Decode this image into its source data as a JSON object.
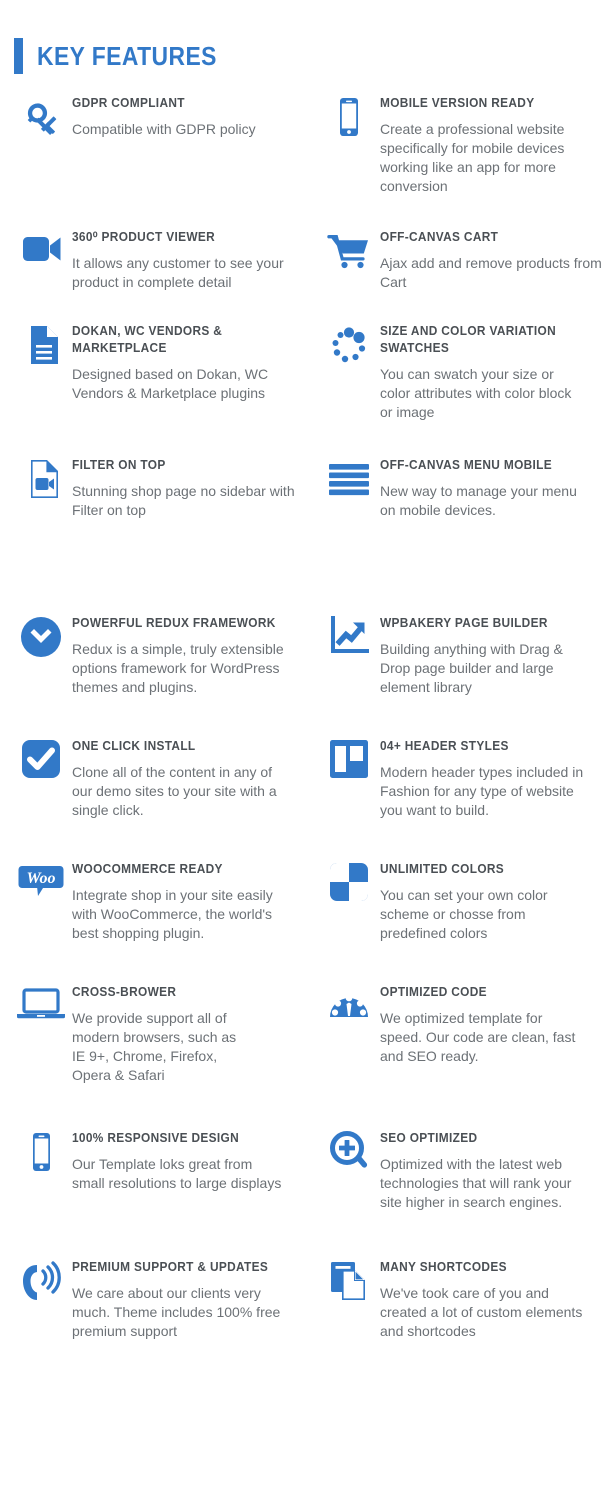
{
  "heading": {
    "bar_color": "#3279c8",
    "title": "KEY FEATURES"
  },
  "theme": {
    "accent": "#3279c8",
    "title_color": "#4a4f54",
    "body_color": "#6c7176",
    "background": "#ffffff"
  },
  "sections": [
    {
      "id": "section-1",
      "rows": [
        {
          "left": {
            "icon": "key-icon",
            "title": "GDPR COMPLIANT",
            "desc": "Compatible with GDPR policy"
          },
          "right": {
            "icon": "mobile-phone-icon",
            "title": "MOBILE VERSION READY",
            "desc": "Create a professional website specifically for mobile devices working like an app for more conversion"
          }
        },
        {
          "left": {
            "icon": "video-camera-icon",
            "title": "360⁰  PRODUCT VIEWER",
            "desc": "It allows any customer to see your product in complete detail"
          },
          "right": {
            "icon": "shopping-cart-icon",
            "title": "OFF-CANVAS CART",
            "desc": "Ajax add and remove products from Cart"
          }
        },
        {
          "left": {
            "icon": "document-lines-icon",
            "title": "DOKAN, WC VENDORS & MARKETPLACE",
            "desc": "Designed based on Dokan, WC Vendors & Marketplace plugins"
          },
          "right": {
            "icon": "spinner-dots-icon",
            "title": "SIZE AND COLOR VARIATION SWATCHES",
            "desc": "You can swatch your size or color attributes with color block or image"
          }
        },
        {
          "left": {
            "icon": "file-video-icon",
            "title": "FILTER ON TOP",
            "desc": "Stunning shop page no sidebar with Filter on top"
          },
          "right": {
            "icon": "hamburger-menu-icon",
            "title": "OFF-CANVAS MENU MOBILE",
            "desc": "New way to manage your menu on mobile devices."
          }
        }
      ]
    },
    {
      "id": "section-2",
      "rows": [
        {
          "left": {
            "icon": "chevron-down-circle-icon",
            "title": "POWERFUL REDUX FRAMEWORK",
            "desc": "Redux is a simple, truly extensible options framework for WordPress themes and plugins."
          },
          "right": {
            "icon": "growth-chart-icon",
            "title": "WPBAKERY PAGE BUILDER",
            "desc": "Building anything with Drag & Drop page builder and large element library"
          }
        },
        {
          "left": {
            "icon": "checkmark-square-icon",
            "title": "ONE CLICK INSTALL",
            "desc": "Clone all of the content in any of our demo sites to your site with a single click."
          },
          "right": {
            "icon": "layout-columns-icon",
            "title": "04+ HEADER STYLES",
            "desc": "Modern header types included in Fashion for any type of website you want to build."
          }
        },
        {
          "left": {
            "icon": "woocommerce-logo-icon",
            "title": "WOOCOMMERCE READY",
            "desc": "Integrate shop in your site easily with WooCommerce, the world's best shopping plugin."
          },
          "right": {
            "icon": "checkerboard-colors-icon",
            "title": "UNLIMITED COLORS",
            "desc": "You can set your own color scheme or chosse from predefined colors"
          }
        },
        {
          "left": {
            "icon": "laptop-icon",
            "title": "CROSS-BROWER",
            "desc": "We provide support all of modern browsers, such as IE 9+, Chrome, Firefox, Opera & Safari"
          },
          "right": {
            "icon": "speedometer-icon",
            "title": "OPTIMIZED CODE",
            "desc": "We optimized template for speed. Our code are clean, fast and SEO ready."
          }
        },
        {
          "left": {
            "icon": "smartphone-icon",
            "title": "100% RESPONSIVE DESIGN",
            "desc": "Our Template loks great from small resolutions to large displays"
          },
          "right": {
            "icon": "magnifier-plus-icon",
            "title": "SEO OPTIMIZED",
            "desc": "Optimized with the latest web technologies that will rank your site higher in search engines."
          }
        },
        {
          "left": {
            "icon": "phone-ringing-icon",
            "title": "PREMIUM SUPPORT & UPDATES",
            "desc": "We care about our clients very much. Theme includes 100% free premium support"
          },
          "right": {
            "icon": "copy-documents-icon",
            "title": "MANY SHORTCODES",
            "desc": "We've took care of you and created a lot of custom elements and shortcodes"
          }
        }
      ]
    }
  ]
}
